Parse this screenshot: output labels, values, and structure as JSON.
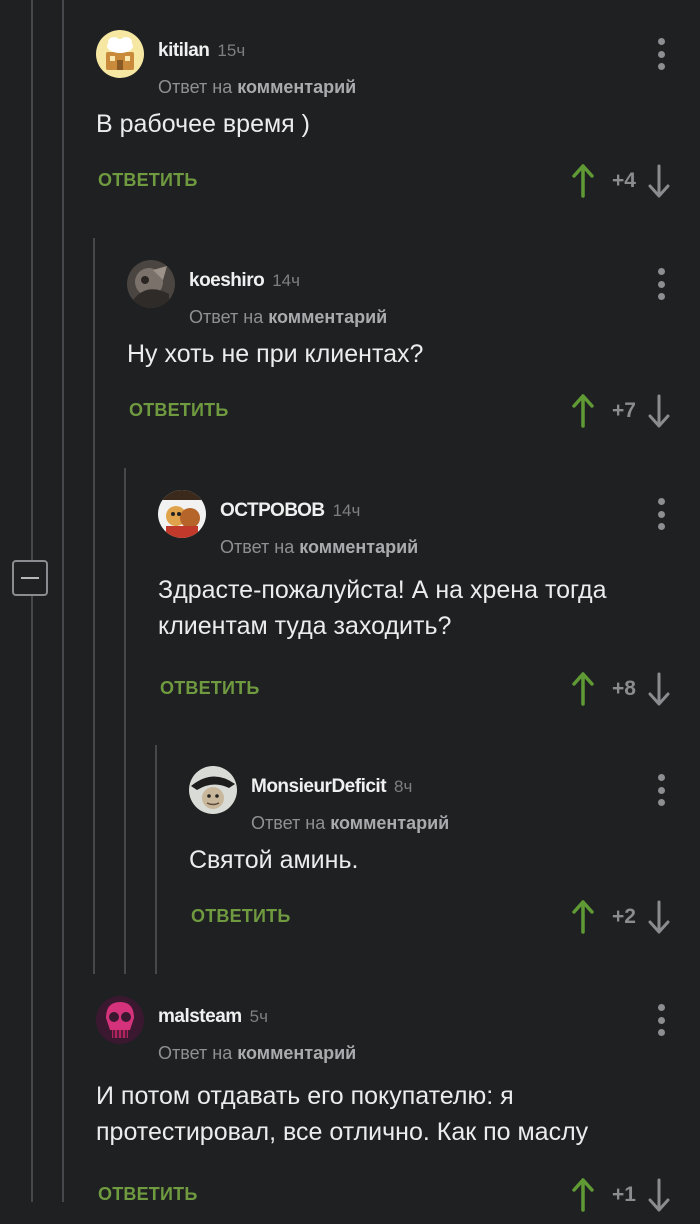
{
  "comments": [
    {
      "username": "kitilan",
      "time": "15ч",
      "reply_prefix": "Ответ на",
      "reply_target": "комментарий",
      "text": "В рабочее время )",
      "reply_label": "ОТВЕТИТЬ",
      "score": "+4"
    },
    {
      "username": "koeshiro",
      "time": "14ч",
      "reply_prefix": "Ответ на",
      "reply_target": "комментарий",
      "text": "Ну хоть не при клиентах?",
      "reply_label": "ОТВЕТИТЬ",
      "score": "+7"
    },
    {
      "username": "ОСТРОВОВ",
      "time": "14ч",
      "reply_prefix": "Ответ на",
      "reply_target": "комментарий",
      "text": "Здрасте-пожалуйста! А на хрена тогда\nклиентам туда заходить?",
      "reply_label": "ОТВЕТИТЬ",
      "score": "+8"
    },
    {
      "username": "MonsieurDeficit",
      "time": "8ч",
      "reply_prefix": "Ответ на",
      "reply_target": "комментарий",
      "text": "Святой аминь.",
      "reply_label": "ОТВЕТИТЬ",
      "score": "+2"
    },
    {
      "username": "malsteam",
      "time": "5ч",
      "reply_prefix": "Ответ на",
      "reply_target": "комментарий",
      "text": "И потом отдавать его покупателю: я\nпротестировал, все отлично. Как по маслу",
      "reply_label": "ОТВЕТИТЬ",
      "score": "+1"
    }
  ],
  "colors": {
    "background": "#1f2022",
    "reply_green": "#6f9a3f",
    "upvote_green": "#5f9a35",
    "muted_gray": "#8a8c8f"
  },
  "icons": [
    "collapse-thread-icon",
    "more-options-icon",
    "upvote-arrow-icon",
    "downvote-arrow-icon"
  ]
}
